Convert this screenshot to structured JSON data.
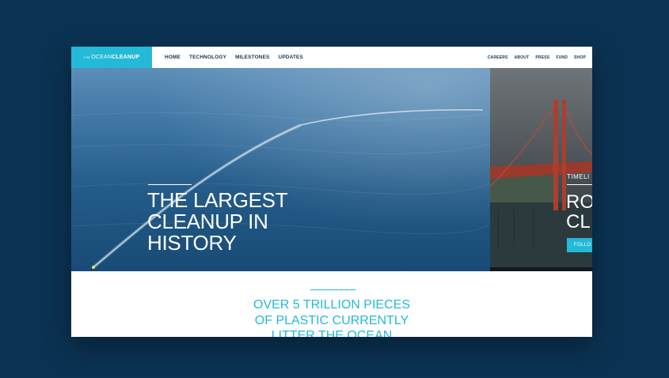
{
  "header": {
    "logo": {
      "prefix": "THE",
      "thin": "OCEAN",
      "bold": "CLEANUP"
    },
    "main_nav": [
      "HOME",
      "TECHNOLOGY",
      "MILESTONES",
      "UPDATES"
    ],
    "secondary_nav": [
      "CAREERS",
      "ABOUT",
      "PRESS",
      "FUND",
      "SHOP"
    ]
  },
  "hero": {
    "title_lines": [
      "THE LARGEST",
      "CLEANUP IN",
      "HISTORY"
    ]
  },
  "slide": {
    "label": "TIMELI",
    "title_lines": [
      "RO",
      "CL"
    ],
    "button": "FOLLO"
  },
  "stat": {
    "lines": [
      "OVER 5 TRILLION PIECES",
      "OF PLASTIC CURRENTLY",
      "LITTER THE OCEAN"
    ]
  },
  "colors": {
    "accent": "#24b9d6",
    "navy": "#123352",
    "backdrop": "#0b3252"
  }
}
